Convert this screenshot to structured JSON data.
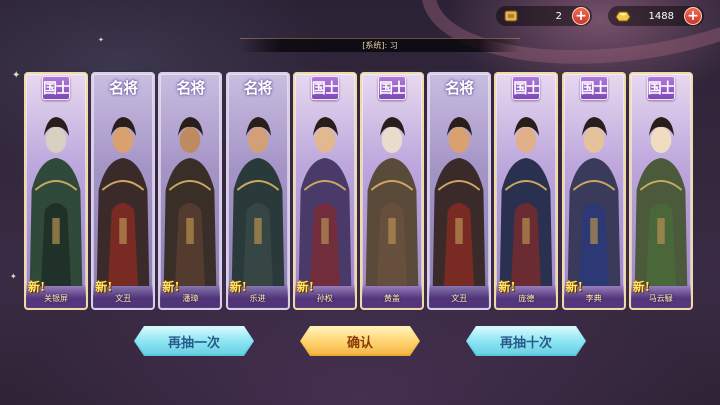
{
  "resources": [
    {
      "icon": "scroll-token-icon",
      "value": "2"
    },
    {
      "icon": "gold-ingot-icon",
      "value": "1488"
    }
  ],
  "marquee": {
    "text": "[系统]: 习"
  },
  "cards": [
    {
      "tier": "国士",
      "tier_type": "guo",
      "new_label": "新!",
      "name": "关银屏"
    },
    {
      "tier": "名将",
      "tier_type": "ming",
      "new_label": "新!",
      "name": "文丑"
    },
    {
      "tier": "名将",
      "tier_type": "ming",
      "new_label": "新!",
      "name": "潘璋"
    },
    {
      "tier": "名将",
      "tier_type": "ming",
      "new_label": "新!",
      "name": "乐进"
    },
    {
      "tier": "国士",
      "tier_type": "guo",
      "new_label": "新!",
      "name": "孙权"
    },
    {
      "tier": "国士",
      "tier_type": "guo",
      "new_label": "",
      "name": "黄盖"
    },
    {
      "tier": "名将",
      "tier_type": "ming",
      "new_label": "",
      "name": "文丑"
    },
    {
      "tier": "国士",
      "tier_type": "guo",
      "new_label": "新!",
      "name": "庞德"
    },
    {
      "tier": "国士",
      "tier_type": "guo",
      "new_label": "新!",
      "name": "李典"
    },
    {
      "tier": "国士",
      "tier_type": "guo",
      "new_label": "新!",
      "name": "马云騄"
    }
  ],
  "buttons": {
    "draw_once": "再抽一次",
    "confirm": "确认",
    "draw_ten": "再抽十次"
  },
  "colors": {
    "accent_cyan": "#7ee3f2",
    "accent_gold": "#ffd060",
    "card_frame": "#a595c7"
  }
}
